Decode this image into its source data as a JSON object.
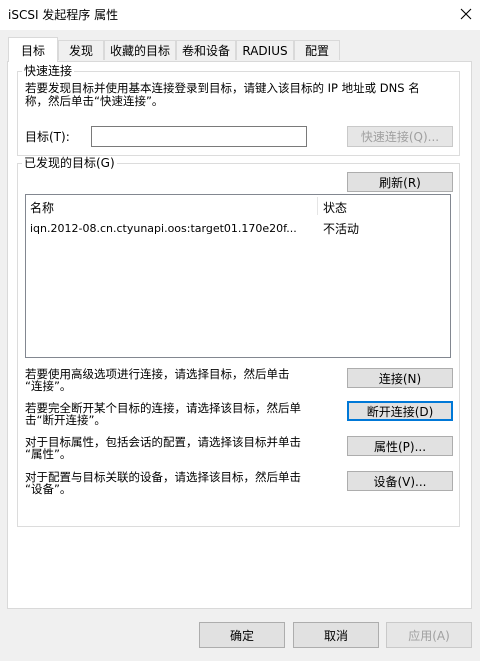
{
  "window": {
    "title": "iSCSI 发起程序 属性"
  },
  "tabs": [
    {
      "label": "目标"
    },
    {
      "label": "发现"
    },
    {
      "label": "收藏的目标"
    },
    {
      "label": "卷和设备"
    },
    {
      "label": "RADIUS"
    },
    {
      "label": "配置"
    }
  ],
  "quick_connect": {
    "title": "快速连接",
    "description_line1": "若要发现目标并使用基本连接登录到目标，请键入该目标的 IP 地址或 DNS 名",
    "description_line2": "称，然后单击“快速连接”。",
    "target_label": "目标(T):",
    "target_value": "",
    "button_label": "快速连接(Q)..."
  },
  "discovered": {
    "title": "已发现的目标(G)",
    "refresh_label": "刷新(R)",
    "columns": {
      "name": "名称",
      "status": "状态"
    },
    "rows": [
      {
        "name": "iqn.2012-08.cn.ctyunapi.oos:target01.170e20f...",
        "status": "不活动"
      }
    ]
  },
  "actions": [
    {
      "line1": "若要使用高级选项进行连接，请选择目标，然后单击",
      "line2": "“连接”。",
      "button": "连接(N)"
    },
    {
      "line1": "若要完全断开某个目标的连接，请选择该目标，然后单",
      "line2": "击“断开连接”。",
      "button": "断开连接(D)"
    },
    {
      "line1": "对于目标属性，包括会话的配置，请选择该目标并单击",
      "line2": "“属性”。",
      "button": "属性(P)..."
    },
    {
      "line1": "对于配置与目标关联的设备，请选择该目标，然后单击",
      "line2": "“设备”。",
      "button": "设备(V)..."
    }
  ],
  "footer": {
    "ok": "确定",
    "cancel": "取消",
    "apply": "应用(A)"
  },
  "colors": {
    "focus_border": "#0078d7",
    "disabled_text": "#a0a0a0"
  }
}
